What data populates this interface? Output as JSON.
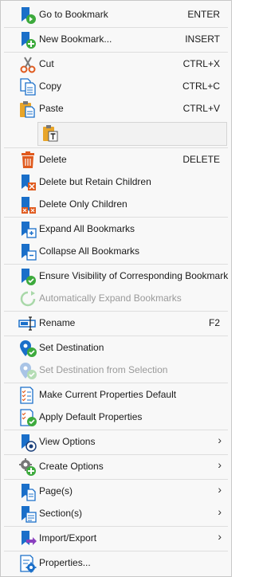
{
  "menu": {
    "go_to_bookmark": {
      "label": "Go to Bookmark",
      "shortcut": "ENTER"
    },
    "new_bookmark": {
      "label": "New Bookmark...",
      "shortcut": "INSERT"
    },
    "cut": {
      "label": "Cut",
      "shortcut": "CTRL+X"
    },
    "copy": {
      "label": "Copy",
      "shortcut": "CTRL+C"
    },
    "paste": {
      "label": "Paste",
      "shortcut": "CTRL+V"
    },
    "delete": {
      "label": "Delete",
      "shortcut": "DELETE"
    },
    "delete_retain": {
      "label": "Delete but Retain Children"
    },
    "delete_children": {
      "label": "Delete Only Children"
    },
    "expand_all": {
      "label": "Expand All Bookmarks"
    },
    "collapse_all": {
      "label": "Collapse All Bookmarks"
    },
    "ensure_visibility": {
      "label": "Ensure Visibility of Corresponding Bookmark"
    },
    "auto_expand": {
      "label": "Automatically Expand Bookmarks"
    },
    "rename": {
      "label": "Rename",
      "shortcut": "F2"
    },
    "set_destination": {
      "label": "Set Destination"
    },
    "set_destination_selection": {
      "label": "Set Destination from Selection"
    },
    "make_default": {
      "label": "Make Current Properties Default"
    },
    "apply_default": {
      "label": "Apply Default Properties"
    },
    "view_options": {
      "label": "View Options"
    },
    "create_options": {
      "label": "Create Options"
    },
    "pages": {
      "label": "Page(s)"
    },
    "sections": {
      "label": "Section(s)"
    },
    "import_export": {
      "label": "Import/Export"
    },
    "properties": {
      "label": "Properties..."
    }
  },
  "submenu_arrow": "›",
  "colors": {
    "accent_blue": "#1a6fc9",
    "accent_green": "#3daa3d",
    "delete_orange": "#e05a1e"
  }
}
